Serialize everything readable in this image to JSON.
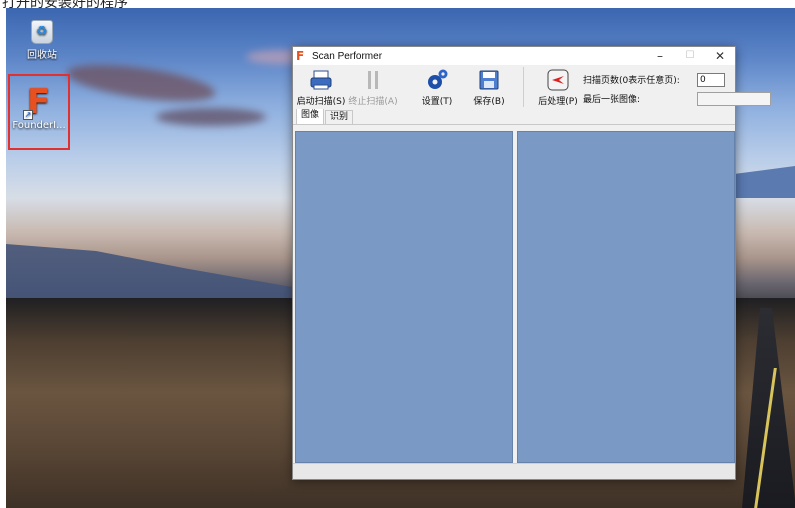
{
  "caption": "打开的安装好的程序",
  "desktop": {
    "icons": [
      {
        "label": "回收站",
        "icon": "recycle-bin-icon"
      },
      {
        "label": "FounderI...",
        "icon": "founder-app-icon"
      }
    ]
  },
  "window": {
    "title": "Scan Performer",
    "controls": {
      "minimize": "–",
      "maximize": "☐",
      "close": "✕"
    },
    "toolbar": {
      "start_scan": "启动扫描(S)",
      "stop_scan": "终止扫描(A)",
      "settings": "设置(T)",
      "save": "保存(B)",
      "post_process": "后处理(P)"
    },
    "fields": {
      "page_count_label": "扫描页数(0表示任意页):",
      "page_count_value": "0",
      "last_image_label": "最后一张图像:",
      "last_image_value": ""
    },
    "tabs": [
      "图像",
      "识别"
    ],
    "active_tab": 0,
    "colors": {
      "panel": "#7a99c4",
      "accent": "#e8501f"
    }
  }
}
